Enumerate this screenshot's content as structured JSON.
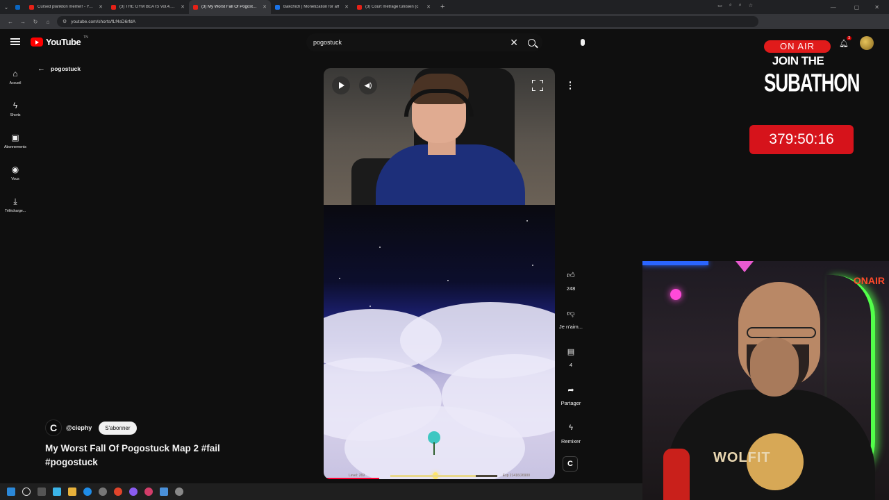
{
  "browser": {
    "tabs": [
      {
        "title": "Cursed plankton meme!! - YouTube",
        "color": "#e62117",
        "active": false
      },
      {
        "title": "(3) THE GYM BEATS Vol.4.3 - T",
        "color": "#e62117",
        "active": false
      },
      {
        "title": "(3) My Worst Fall Of Pogostuck",
        "color": "#e62117",
        "active": true
      },
      {
        "title": "Bakchich | Monetization for aff",
        "color": "#1a73e8",
        "active": false
      },
      {
        "title": "(3) Court métrage tunisien (c",
        "color": "#e62117",
        "active": false
      }
    ],
    "url": "youtube.com/shorts/fLf4sD6rfdA"
  },
  "youtube": {
    "logo_text": "YouTube",
    "country_code": "TN",
    "search_query": "pogostuck",
    "notification_count": "3",
    "back_label": "pogostuck"
  },
  "sidebar": {
    "items": [
      {
        "label": "Accueil",
        "icon": "home-icon"
      },
      {
        "label": "Shorts",
        "icon": "shorts-icon"
      },
      {
        "label": "Abonnements",
        "icon": "subscriptions-icon"
      },
      {
        "label": "Vous",
        "icon": "you-icon"
      },
      {
        "label": "Télécharge...",
        "icon": "download-icon"
      }
    ]
  },
  "short": {
    "channel": "@ciephy",
    "subscribe_label": "S'abonner",
    "title": "My Worst Fall Of Pogostuck Map 2 #fail #pogostuck",
    "hud_level": "Level: 269",
    "hud_exp": "Exp  21416/26900",
    "hud_exp_progress": 0.8,
    "playback_progress": 0.24
  },
  "actions": {
    "likes": "248",
    "dislike_label": "Je n'aim...",
    "comments": "4",
    "share_label": "Partager",
    "remix_label": "Remixer"
  },
  "stream": {
    "on_air": "ON AIR",
    "join": "JOIN THE",
    "subathon": "SUBATHON",
    "timer": "379:50:16",
    "neon_sign": "ONAIR",
    "shirt_text": "WOLFIT"
  }
}
